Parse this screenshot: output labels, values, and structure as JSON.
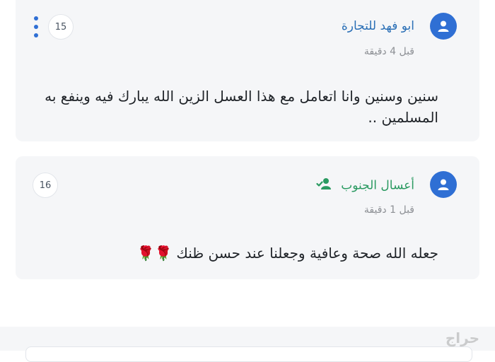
{
  "comments": [
    {
      "author": "ابو فهد للتجارة",
      "time": "قبل 4 دقيقة",
      "count": "15",
      "text": "سنين وسنين وانا اتعامل مع هذا العسل الزين الله يبارك فيه وينفع به المسلمين .."
    },
    {
      "author": "أعسال الجنوب",
      "time": "قبل 1 دقيقة",
      "count": "16",
      "text": "جعله الله صحة وعافية وجعلنا عند حسن ظنك",
      "emoji": "🌹🌹"
    }
  ],
  "watermark": "حراج",
  "colors": {
    "accent": "#2f6fd4",
    "author_link": "#2a6fb6",
    "verified_green": "#2a9a61",
    "card_bg": "#f5f6f8"
  },
  "icons": {
    "avatar": "user-icon",
    "menu": "more-vertical-icon",
    "verified": "user-check-icon"
  }
}
